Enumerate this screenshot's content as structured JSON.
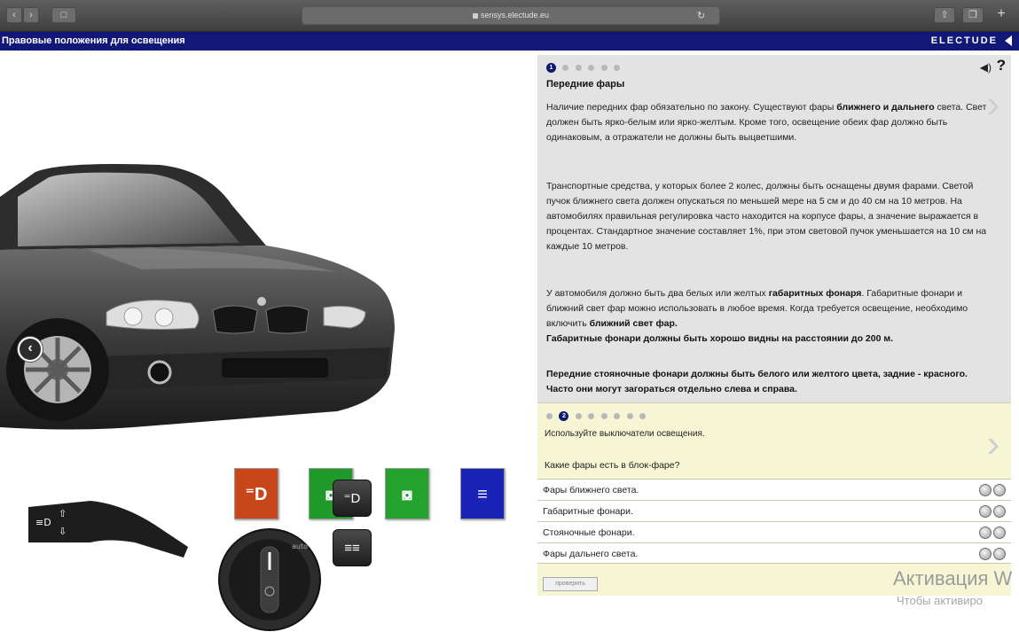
{
  "browser": {
    "url": "sensys.electude.eu"
  },
  "app": {
    "title": "Правовые положения для освещения",
    "brand": "ELECTUDE"
  },
  "lesson": {
    "page_current": "1",
    "section_title": "Передние фары",
    "paragraphs": [
      "Наличие передних фар обязательно по закону. Существуют фары <b>ближнего и дальнего</b> света. Свет должен быть ярко-белым или ярко-желтым. Кроме того, освещение обеих фар должно быть одинаковым, а отражатели не должны быть выцветшими.",
      "Транспортные средства, у которых более 2 колес, должны быть оснащены двумя фарами. Светой пучок ближнего света должен опускаться по меньшей мере на 5 см и до 40 см на 10 метров. На автомобилях правильная регулировка часто находится на корпусе фары, а значение выражается в процентах. Стандартное значение составляет 1%, при этом световой пучок уменьшается на 10 см на каждые 10 метров.",
      "У автомобиля должно быть два белых или желтых <b>габаритных фонаря</b>. Габаритные фонари и ближний свет фар можно использовать в любое время. Когда требуется освещение, необходимо включить <b>ближний свет фар.</b><br><b>Габаритные фонари должны быть хорошо видны на расстоянии до 200 м.</b>",
      "<b>Передние стояночные фонари должны быть белого или желтого цвета, задние - красного. Часто они могут загораться отдельно слева и справа.</b>"
    ]
  },
  "quiz": {
    "page_current": "2",
    "instruction": "Используйте выключатели освещения.",
    "question": "Какие фары есть в блок-фаре?",
    "answers": [
      "Фары ближнего света.",
      "Габаритные фонари.",
      "Стояночные фонари.",
      "Фары дальнего света."
    ],
    "check_label": "проверить"
  },
  "controls": {
    "indicator_colors": [
      "#c9461b",
      "#1f9a2a",
      "#23a22d",
      "#1a23b8"
    ]
  },
  "watermark": {
    "line1": "Активация W",
    "line2": "Чтобы активиро"
  }
}
